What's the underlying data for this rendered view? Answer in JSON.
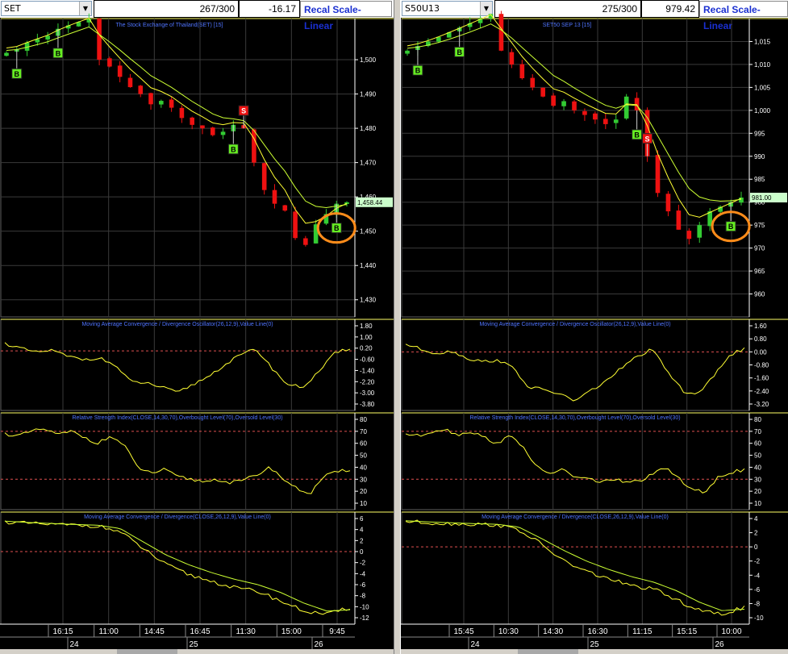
{
  "colors": {
    "up": "#33cc33",
    "down": "#ee1111",
    "ma": "#ffff33",
    "ma2": "#ccff33",
    "grid": "#3a3a3a",
    "title": "#4f74ff",
    "ref": "#e05050",
    "axis": "#ffffff",
    "circle": "#ff8c1a",
    "buy": "#66ee22",
    "sell": "#ee1111"
  },
  "panels": [
    {
      "symbol": "SET",
      "counter": "267/300",
      "change": "-16.17",
      "recal_label": "Recal Scale-Linear",
      "price_title": "The Stock Exchange of Thailand(SET) [15]",
      "current_price": "1,458.44",
      "price_ticks": [
        "1,500",
        "1,490",
        "1,480",
        "1,470",
        "1,460",
        "1,450",
        "1,440",
        "1,430"
      ],
      "macd_title": "Moving Average Convergence / Divergence Oscillator(26,12,9),Value Line(0)",
      "macd_ticks": [
        "1.80",
        "1.00",
        "0.20",
        "-0.60",
        "-1.40",
        "-2.20",
        "-3.00",
        "-3.80"
      ],
      "rsi_title": "Relative Strength Index(CLOSE,14,30,70),Overbought Level(70),Oversold Level(30)",
      "rsi_ticks": [
        "80",
        "70",
        "60",
        "50",
        "40",
        "30",
        "20",
        "10"
      ],
      "macd2_title": "Moving Average Convergence / Divergence(CLOSE,26,12,9),Value Line(0)",
      "macd2_ticks": [
        "6",
        "4",
        "2",
        "0",
        "-2",
        "-4",
        "-6",
        "-8",
        "-10",
        "-12"
      ],
      "time_ticks": [
        "16:15",
        "11:00",
        "14:45",
        "16:45",
        "11:30",
        "15:00",
        "9:45"
      ],
      "date_ticks": [
        "24",
        "25",
        "26"
      ],
      "buy_label": "B",
      "sell_label": "S"
    },
    {
      "symbol": "S50U13",
      "counter": "275/300",
      "change": "979.42",
      "recal_label": "Recal Scale-Linear",
      "price_title": "SET50 SEP 13  [15]",
      "current_price": "981.00",
      "price_ticks": [
        "1,015",
        "1,010",
        "1,005",
        "1,000",
        "995",
        "990",
        "985",
        "980",
        "975",
        "970",
        "965",
        "960"
      ],
      "macd_title": "Moving Average Convergence / Divergence Oscillator(26,12,9),Value Line(0)",
      "macd_ticks": [
        "1.60",
        "0.80",
        "0.00",
        "-0.80",
        "-1.60",
        "-2.40",
        "-3.20"
      ],
      "rsi_title": "Relative Strength Index(CLOSE,14,30,70),Overbought Level(70),Oversold Level(30)",
      "rsi_ticks": [
        "80",
        "70",
        "60",
        "50",
        "40",
        "30",
        "20",
        "10"
      ],
      "macd2_title": "Moving Average Convergence / Divergence(CLOSE,26,12,9),Value Line(0)",
      "macd2_ticks": [
        "4",
        "2",
        "0",
        "-2",
        "-4",
        "-6",
        "-8",
        "-10"
      ],
      "time_ticks": [
        "15:45",
        "10:30",
        "14:30",
        "16:30",
        "11:15",
        "15:15",
        "10:00"
      ],
      "date_ticks": [
        "24",
        "25",
        "26"
      ],
      "buy_label": "B",
      "sell_label": "S"
    }
  ],
  "chart_data": [
    {
      "type": "line",
      "title": "The Stock Exchange of Thailand(SET) [15]",
      "series": [
        {
          "values": [
            1502,
            1503,
            1505,
            1506,
            1507,
            1509,
            1510,
            1511,
            1512,
            1500,
            1498,
            1495,
            1492,
            1490,
            1487,
            1488,
            1486,
            1483,
            1481,
            1480,
            1478,
            1479,
            1481,
            1480,
            1470,
            1462,
            1458,
            1456,
            1448,
            1446,
            1452,
            1455,
            1458,
            1458.44
          ]
        }
      ],
      "ylim": [
        1425,
        1512
      ]
    },
    {
      "type": "line",
      "title": "SET50 SEP 13  [15]",
      "series": [
        {
          "values": [
            1013,
            1014,
            1015,
            1016,
            1017,
            1018,
            1019,
            1020,
            1021,
            1013,
            1010,
            1007,
            1005,
            1003,
            1001,
            1002,
            1000,
            999,
            998,
            997,
            998,
            1003,
            1000,
            990,
            982,
            978,
            974,
            972,
            975,
            978,
            979,
            980,
            981
          ]
        }
      ],
      "ylim": [
        955,
        1020
      ]
    }
  ]
}
